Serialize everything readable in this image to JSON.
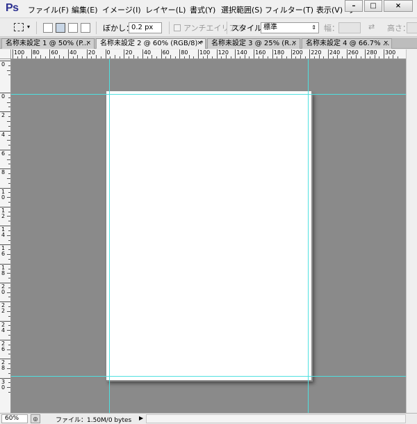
{
  "menubar": {
    "logo": "Ps",
    "items": [
      "ファイル(F)",
      "編集(E)",
      "イメージ(I)",
      "レイヤー(L)",
      "書式(Y)",
      "選択範囲(S)",
      "フィルター(T)",
      "表示(V)",
      "ウ"
    ],
    "window_controls": [
      "–",
      "□",
      "×"
    ]
  },
  "options": {
    "feather_label": "ぼかし：",
    "feather_value": "0.2 px",
    "antialias_label": "アンチエイリアス",
    "style_label": "スタイル：",
    "style_value": "標準",
    "width_label": "幅：",
    "height_label": "高さ："
  },
  "tabs": [
    {
      "label": "名称未設定 1 @ 50% (P...",
      "close": "×",
      "active": false
    },
    {
      "label": "名称未設定 2 @ 60% (RGB/8) *",
      "close": "×",
      "active": true
    },
    {
      "label": "名称未設定 3 @ 25% (R...",
      "close": "×",
      "active": false
    },
    {
      "label": "名称未設定 4 @ 66.7% ...",
      "close": "×",
      "active": false
    }
  ],
  "ruler_top_labels": [
    "100",
    "80",
    "60",
    "40",
    "20",
    "0",
    "20",
    "40",
    "60",
    "80",
    "100",
    "120",
    "140",
    "160",
    "180",
    "200",
    "220",
    "240",
    "260",
    "280",
    "300"
  ],
  "ruler_left_labels": [
    "0",
    "0",
    "2",
    "4",
    "6",
    "8",
    "10",
    "12",
    "14",
    "16",
    "18",
    "20",
    "22",
    "24",
    "26",
    "28",
    "30"
  ],
  "status": {
    "zoom": "60%",
    "info": "ファイル：1.50M/0 bytes",
    "arrow": "▶"
  },
  "colors": {
    "guide": "#4fe0e0",
    "pasteboard": "#8a8a8a",
    "logo": "#2b2f8f"
  }
}
